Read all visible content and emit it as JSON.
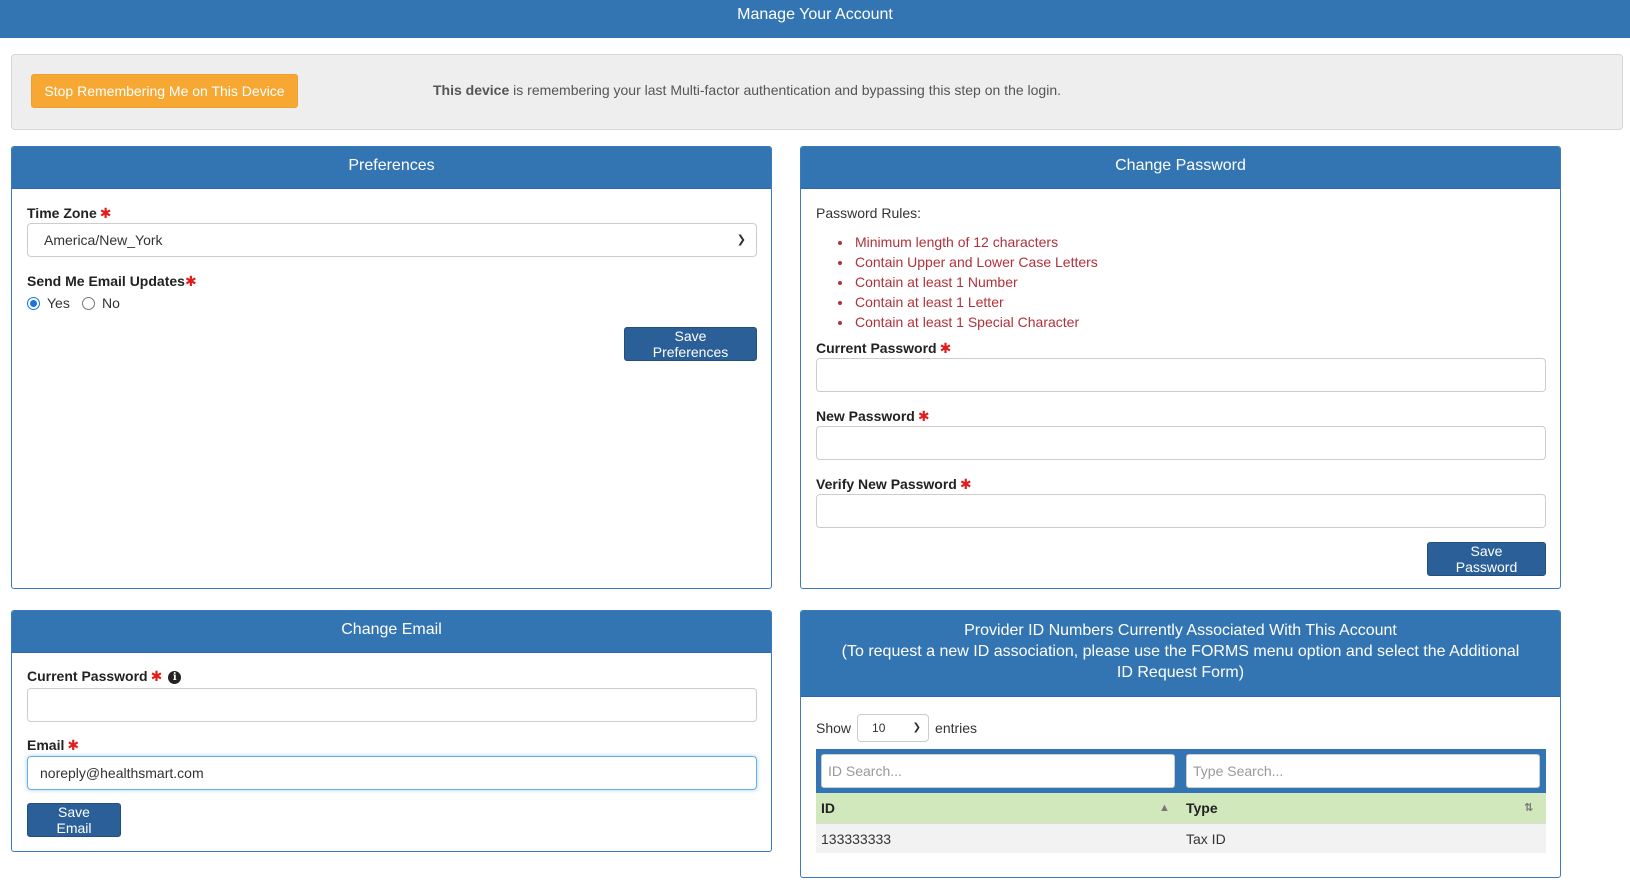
{
  "header": {
    "title": "Manage Your Account"
  },
  "device_bar": {
    "button_label": "Stop Remembering Me on This Device",
    "message_bold": "This device",
    "message_rest": " is remembering your last Multi-factor authentication and bypassing this step on the login."
  },
  "preferences": {
    "title": "Preferences",
    "timezone_label": "Time Zone",
    "timezone_value": "America/New_York",
    "email_updates_label": "Send Me Email Updates",
    "yes_label": "Yes",
    "no_label": "No",
    "selected": "Yes",
    "save_label": "Save Preferences"
  },
  "change_password": {
    "title": "Change Password",
    "rules_title": "Password Rules:",
    "rules": [
      "Minimum length of 12 characters",
      "Contain Upper and Lower Case Letters",
      "Contain at least 1 Number",
      "Contain at least 1 Letter",
      "Contain at least 1 Special Character"
    ],
    "current_label": "Current Password",
    "new_label": "New Password",
    "verify_label": "Verify New Password",
    "current_value": "",
    "new_value": "",
    "verify_value": "",
    "save_label": "Save Password"
  },
  "change_email": {
    "title": "Change Email",
    "password_label": "Current Password",
    "password_value": "",
    "email_label": "Email",
    "email_value": "noreply@healthsmart.com",
    "save_label": "Save Email"
  },
  "provider_ids": {
    "title_line1": "Provider ID Numbers Currently Associated With This Account",
    "title_line2": "(To request a new ID association, please use the FORMS menu option and select the Additional ID Request Form)",
    "show_label": "Show",
    "entries_value": "10",
    "entries_label": "entries",
    "id_search_placeholder": "ID Search...",
    "type_search_placeholder": "Type Search...",
    "columns": [
      "ID",
      "Type"
    ],
    "rows": [
      {
        "id": "133333333",
        "type": "Tax ID"
      }
    ]
  },
  "colors": {
    "header_blue": "#3375b3",
    "button_blue": "#2b5f97",
    "button_orange": "#f7a833",
    "rule_red": "#b0313a",
    "required_red": "#e31b1b",
    "table_header_green": "#d1e8bd"
  },
  "icons": {
    "required": "asterisk-icon",
    "info": "info-icon",
    "select_caret": "chevron-down-icon",
    "sort_asc": "sort-up-icon",
    "sort_both": "sort-both-icon"
  }
}
